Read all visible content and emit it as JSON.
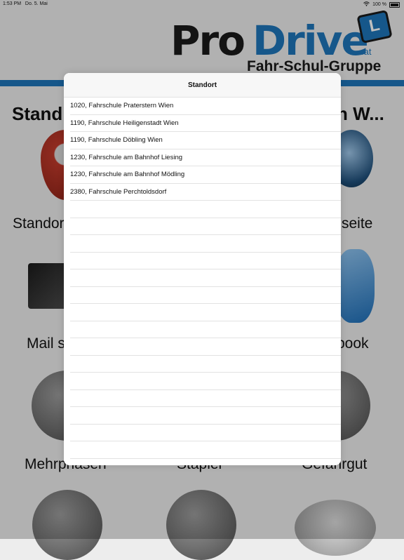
{
  "status": {
    "time": "1:53 PM",
    "date": "Do. 5. Mai",
    "battery": "100 %"
  },
  "logo": {
    "pro": "Pro",
    "drive": "Drive",
    "at": ".at",
    "sub": "Fahr-Schul-Gruppe",
    "badge_letter": "L"
  },
  "background": {
    "heading_left": "Stand",
    "heading_right": "n W...",
    "labels": {
      "r1_left": "Standor",
      "r1_right": "seite",
      "r2_left": "Mail s",
      "r2_right": "book",
      "r3_left": "Mehrphasen",
      "r3_mid": "Stapler",
      "r3_right": "Gefahrgut"
    }
  },
  "popup": {
    "title": "Standort",
    "items": [
      "1020, Fahrschule Praterstern Wien",
      "1190, Fahrschule Heiligenstadt Wien",
      "1190, Fahrschule Döbling Wien",
      "1230, Fahrschule am Bahnhof Liesing",
      "1230, Fahrschule am Bahnhof Mödling",
      "2380, Fahrschule Perchtoldsdorf"
    ],
    "empty_rows": 16
  },
  "colors": {
    "brand_blue": "#1e74b8",
    "dark": "#1a1a1a"
  }
}
